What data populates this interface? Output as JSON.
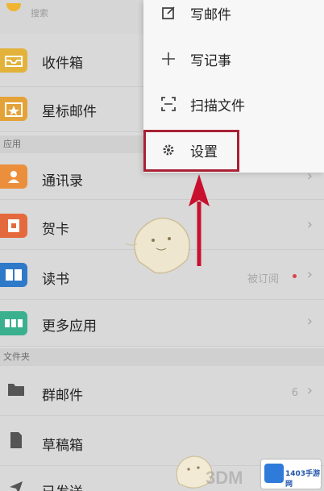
{
  "search": {
    "placeholder_text": "搜索"
  },
  "mailboxes": [
    {
      "label": "收件箱",
      "icon": "inbox-icon",
      "color": "#e2b23a"
    },
    {
      "label": "星标邮件",
      "icon": "star-mail-icon",
      "color": "#e3a338"
    }
  ],
  "sections": {
    "apps": "应用",
    "folders": "文件夹"
  },
  "apps": [
    {
      "label": "通讯录",
      "icon": "contacts-icon",
      "color": "#ec8f3c"
    },
    {
      "label": "贺卡",
      "icon": "greeting-card-icon",
      "color": "#e46a3d"
    },
    {
      "label": "读书",
      "icon": "book-icon",
      "color": "#2f79c9",
      "extra": "被订阅"
    },
    {
      "label": "更多应用",
      "icon": "more-apps-icon",
      "color": "#3ab08f"
    }
  ],
  "folders": [
    {
      "label": "群邮件",
      "icon": "group-mail-icon",
      "extra": "6"
    },
    {
      "label": "草稿箱",
      "icon": "drafts-icon"
    },
    {
      "label": "已发送",
      "icon": "sent-icon"
    }
  ],
  "menu": [
    {
      "label": "写邮件",
      "icon": "compose-icon"
    },
    {
      "label": "写记事",
      "icon": "plus-icon"
    },
    {
      "label": "扫描文件",
      "icon": "scan-icon"
    },
    {
      "label": "设置",
      "icon": "gear-icon"
    }
  ],
  "colors": {
    "highlight": "#a82135",
    "arrow": "#c8102e"
  },
  "watermark": {
    "site": "3DM",
    "badge": "1403手游网"
  }
}
